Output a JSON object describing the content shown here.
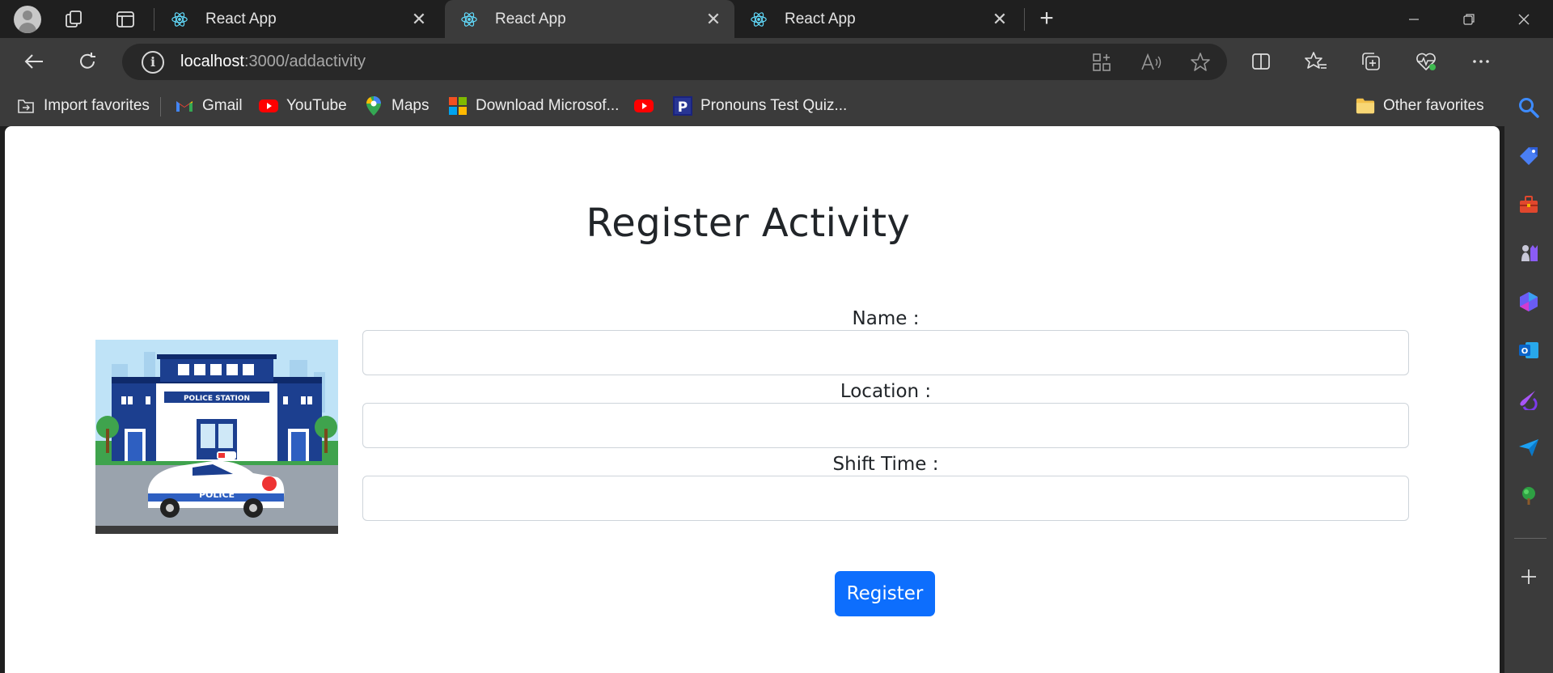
{
  "browser": {
    "tabs": [
      {
        "label": "React App",
        "active": false
      },
      {
        "label": "React App",
        "active": true
      },
      {
        "label": "React App",
        "active": false
      }
    ],
    "new_tab": "+",
    "address": {
      "host": "localhost",
      "path": ":3000/addactivity"
    },
    "favorites": [
      {
        "label": "Import favorites",
        "icon": "import-icon"
      },
      {
        "label": "Gmail",
        "icon": "gmail-icon"
      },
      {
        "label": "YouTube",
        "icon": "youtube-icon"
      },
      {
        "label": "Maps",
        "icon": "maps-icon"
      },
      {
        "label": "Download Microsof...",
        "icon": "microsoft-icon"
      },
      {
        "label": "",
        "icon": "youtube-icon"
      },
      {
        "label": "Pronouns Test Quiz...",
        "icon": "pronouns-icon"
      }
    ],
    "other_favorites": "Other favorites"
  },
  "page": {
    "title": "Register Activity",
    "image_caption": {
      "station_sign": "POLICE STATION",
      "car_text": "POLICE"
    },
    "form": {
      "name_label": "Name :",
      "location_label": "Location :",
      "shift_label": "Shift Time :",
      "name_value": "",
      "location_value": "",
      "shift_value": "",
      "submit_label": "Register"
    }
  },
  "colors": {
    "accent": "#0d6efd",
    "chrome_dark": "#1f1f1f",
    "chrome": "#3b3b3b"
  }
}
